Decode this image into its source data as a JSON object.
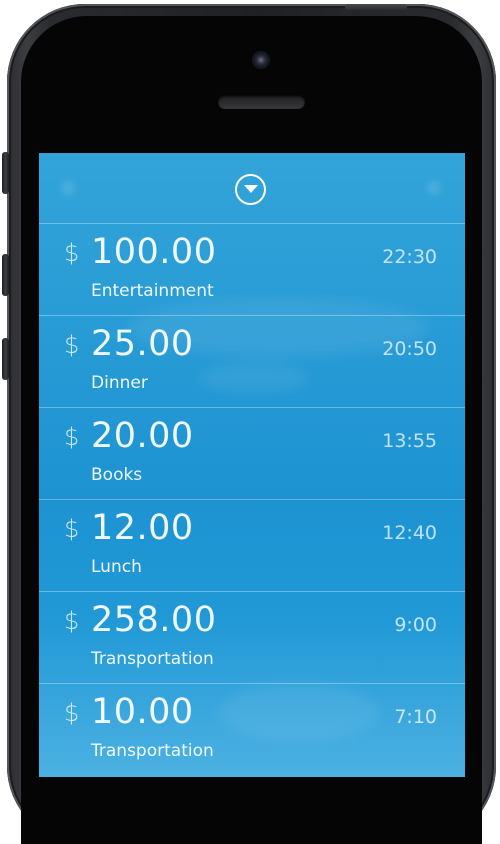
{
  "app": {
    "expand_icon": "chevron-down-circle-icon",
    "accent_color": "#1d93d2"
  },
  "expenses": [
    {
      "currency": "$",
      "amount": "100.00",
      "category": "Entertainment",
      "time": "22:30"
    },
    {
      "currency": "$",
      "amount": "25.00",
      "category": "Dinner",
      "time": "20:50"
    },
    {
      "currency": "$",
      "amount": "20.00",
      "category": "Books",
      "time": "13:55"
    },
    {
      "currency": "$",
      "amount": "12.00",
      "category": "Lunch",
      "time": "12:40"
    },
    {
      "currency": "$",
      "amount": "258.00",
      "category": "Transportation",
      "time": "9:00"
    },
    {
      "currency": "$",
      "amount": "10.00",
      "category": "Transportation",
      "time": "7:10"
    }
  ]
}
